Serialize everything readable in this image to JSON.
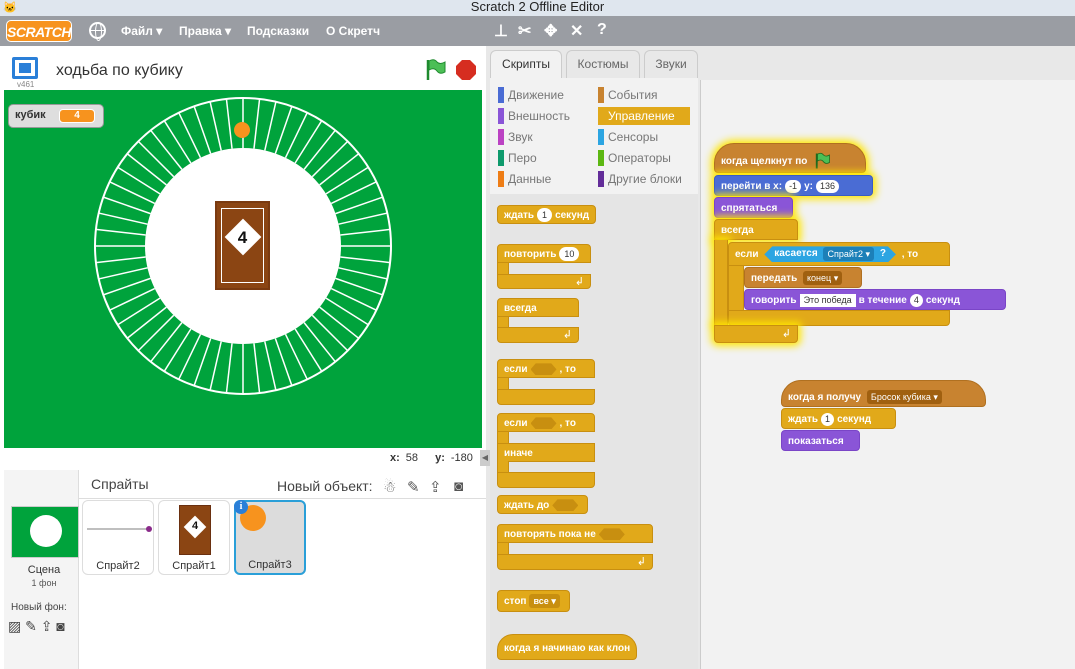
{
  "window": {
    "title": "Scratch 2 Offline Editor"
  },
  "menu": {
    "logo": "SCRATCH",
    "items": [
      "Файл ▾",
      "Правка ▾",
      "Подсказки",
      "О Скретч"
    ]
  },
  "stage": {
    "project_title": "ходьба по кубику",
    "version": "v461",
    "monitor_label": "кубик",
    "monitor_value": "4",
    "card_value": "4",
    "x_label": "x:",
    "x_value": "58",
    "y_label": "y:",
    "y_value": "-180"
  },
  "sprites": {
    "title": "Спрайты",
    "new_object": "Новый объект:",
    "scene_label": "Сцена",
    "scene_sub": "1 фон",
    "new_backdrop": "Новый фон:",
    "items": [
      {
        "name": "Спрайт2"
      },
      {
        "name": "Спрайт1",
        "card": "4"
      },
      {
        "name": "Спрайт3",
        "selected": true
      }
    ]
  },
  "tabs": [
    "Скрипты",
    "Костюмы",
    "Звуки"
  ],
  "categories": {
    "left": [
      "Движение",
      "Внешность",
      "Звук",
      "Перо",
      "Данные"
    ],
    "right": [
      "События",
      "Управление",
      "Сенсоры",
      "Операторы",
      "Другие блоки"
    ],
    "active": "Управление",
    "colors": {
      "motion": "#4a6cd4",
      "looks": "#8a55d7",
      "sound": "#bb42c3",
      "pen": "#0e9a6c",
      "data": "#ee7d16",
      "events": "#c88330",
      "control": "#e1a91a",
      "sensing": "#2ca5e2",
      "operators": "#5cb712",
      "more": "#632d99"
    }
  },
  "palette": {
    "wait": {
      "pre": "ждать",
      "val": "1",
      "post": "секунд"
    },
    "repeat": {
      "pre": "повторить",
      "val": "10"
    },
    "forever": "всегда",
    "if_then": {
      "pre": "если",
      "post": ", то"
    },
    "if_else": {
      "pre": "если",
      "post": ", то",
      "else": "иначе"
    },
    "wait_until": "ждать до",
    "repeat_until": "повторять пока не",
    "stop": {
      "label": "стоп",
      "opt": "все"
    },
    "clone_hat": "когда я начинаю как клон"
  },
  "script1": {
    "hat": "когда щелкнут по",
    "goto": {
      "pre": "перейти в x:",
      "x": "-1",
      "ylabel": "y:",
      "y": "136"
    },
    "hide": "спрятаться",
    "forever": "всегда",
    "if_pre": "если",
    "touching": "касается",
    "touching_opt": "Спрайт2 ▾",
    "touching_q": "?",
    "if_post": ", то",
    "broadcast": "передать",
    "broadcast_opt": "конец",
    "say_pre": "говорить",
    "say_text": "Это победа",
    "say_mid": "в течение",
    "say_secs": "4",
    "say_post": "секунд"
  },
  "script2": {
    "hat": "когда я получу",
    "hat_opt": "Бросок кубика",
    "wait_pre": "ждать",
    "wait_val": "1",
    "wait_post": "секунд",
    "show": "показаться"
  }
}
